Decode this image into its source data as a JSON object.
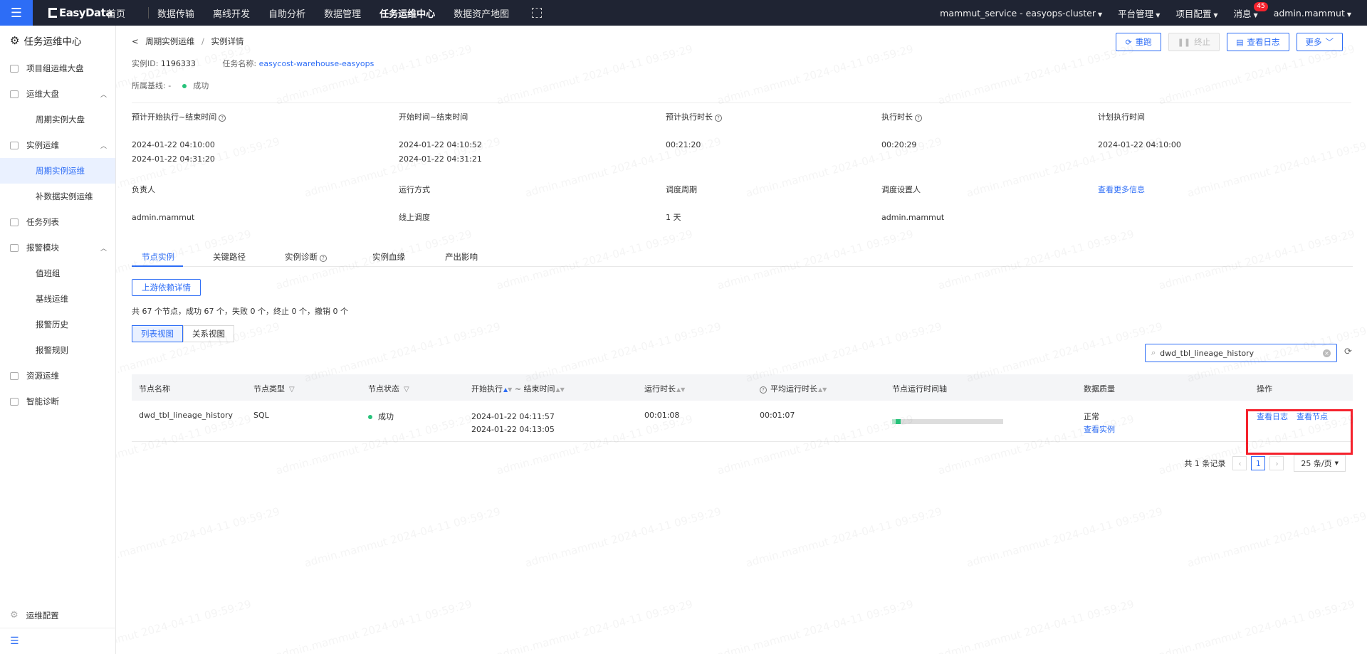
{
  "topbar": {
    "brand": "EasyData",
    "nav": [
      "首页",
      "数据传输",
      "离线开发",
      "自助分析",
      "数据管理",
      "任务运维中心",
      "数据资产地图"
    ],
    "active_nav": "任务运维中心",
    "cluster": "mammut_service - easyops-cluster",
    "platform": "平台管理",
    "project": "项目配置",
    "messages": "消息",
    "message_count": "45",
    "user": "admin.mammut"
  },
  "sidebar": {
    "title": "任务运维中心",
    "items": [
      {
        "label": "项目组运维大盘"
      },
      {
        "label": "运维大盘",
        "children": [
          "周期实例大盘"
        ]
      },
      {
        "label": "实例运维",
        "children": [
          "周期实例运维",
          "补数据实例运维"
        ]
      },
      {
        "label": "任务列表"
      },
      {
        "label": "报警模块",
        "children": [
          "值班组",
          "基线运维",
          "报警历史",
          "报警规则"
        ]
      },
      {
        "label": "资源运维"
      },
      {
        "label": "智能诊断"
      }
    ],
    "active": "周期实例运维",
    "config": "运维配置"
  },
  "breadcrumb": {
    "parent": "周期实例运维",
    "current": "实例详情"
  },
  "instance": {
    "id_label": "实例ID:",
    "id": "1196333",
    "task_label": "任务名称:",
    "task_name": "easycost-warehouse-easyops",
    "baseline_label": "所属基线:",
    "baseline": "-",
    "status": "成功"
  },
  "actions": {
    "rerun": "重跑",
    "stop": "终止",
    "view_log": "查看日志",
    "more": "更多"
  },
  "info": {
    "row1": [
      {
        "label": "预计开始执行~结束时间",
        "help": true,
        "values": [
          "2024-01-22 04:10:00",
          "2024-01-22 04:31:20"
        ]
      },
      {
        "label": "开始时间~结束时间",
        "help": false,
        "values": [
          "2024-01-22 04:10:52",
          "2024-01-22 04:31:21"
        ]
      },
      {
        "label": "预计执行时长",
        "help": true,
        "values": [
          "00:21:20"
        ]
      },
      {
        "label": "执行时长",
        "help": true,
        "values": [
          "00:20:29"
        ]
      },
      {
        "label": "计划执行时间",
        "help": false,
        "values": [
          "2024-01-22 04:10:00"
        ]
      }
    ],
    "row2": [
      {
        "label": "负责人",
        "value": "admin.mammut"
      },
      {
        "label": "运行方式",
        "value": "线上调度"
      },
      {
        "label": "调度周期",
        "value": "1 天"
      },
      {
        "label": "调度设置人",
        "value": "admin.mammut"
      }
    ],
    "more_link": "查看更多信息"
  },
  "tabs": [
    "节点实例",
    "关键路径",
    "实例诊断",
    "实例血缘",
    "产出影响"
  ],
  "active_tab": "节点实例",
  "upstream_button": "上游依赖详情",
  "summary": "共 67 个节点，成功 67 个，失败 0 个，终止 0 个，撤销 0 个",
  "views": [
    "列表视图",
    "关系视图"
  ],
  "search": {
    "value": "dwd_tbl_lineage_history"
  },
  "table": {
    "headers": [
      "节点名称",
      "节点类型",
      "节点状态",
      "开始执行",
      "~ 结束时间",
      "运行时长",
      "平均运行时长",
      "节点运行时间轴",
      "数据质量",
      "操作"
    ],
    "rows": [
      {
        "name": "dwd_tbl_lineage_history",
        "type": "SQL",
        "status": "成功",
        "start": "2024-01-22 04:11:57",
        "end": "2024-01-22 04:13:05",
        "duration": "00:01:08",
        "avg_duration": "00:01:07",
        "timeline_start_fraction": 0.03,
        "timeline_end_fraction": 0.08,
        "quality": "正常",
        "quality_link": "查看实例",
        "op_log": "查看日志",
        "op_node": "查看节点"
      }
    ]
  },
  "pagination": {
    "total": "共 1 条记录",
    "current": "1",
    "page_size": "25 条/页"
  },
  "watermark": "admin.mammut 2024-04-11 09:59:29",
  "colors": {
    "primary": "#2d6df6",
    "success": "#27c27a",
    "topbar": "#1f2433",
    "highlight": "#f5222d"
  }
}
